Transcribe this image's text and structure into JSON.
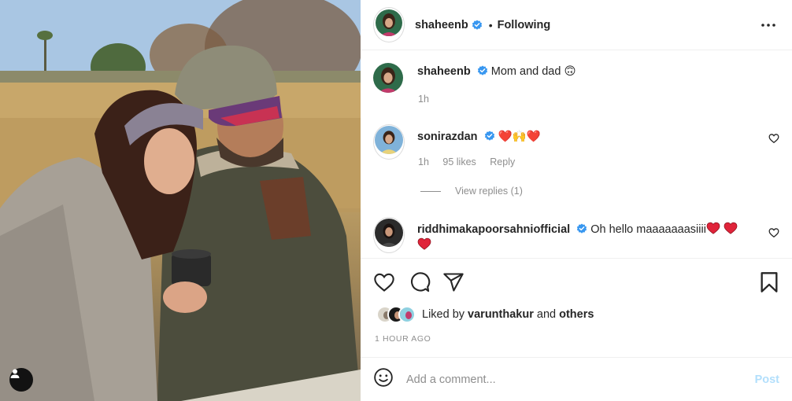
{
  "post": {
    "author": "shaheenb",
    "follow_state": "Following",
    "separator": "•",
    "more_icon": "more-options-icon"
  },
  "caption": {
    "username": "shaheenb",
    "text": "Mom and dad 🙃",
    "time": "1h"
  },
  "comments": [
    {
      "username": "sonirazdan",
      "text": "❤️🙌❤️",
      "time": "1h",
      "likes": "95 likes",
      "reply": "Reply",
      "view_replies": "View replies (1)"
    },
    {
      "username": "riddhimakapoorsahniofficial",
      "text_before": "Oh hello maaaaaaasiiii",
      "text_after": ""
    }
  ],
  "likes": {
    "prefix": "Liked by",
    "user": "varunthakur",
    "middle": "and",
    "suffix": "others"
  },
  "timestamp": "1 HOUR AGO",
  "add_comment": {
    "placeholder": "Add a comment...",
    "post_label": "Post"
  },
  "colors": {
    "verified": "#3897f0",
    "heart_red": "#ed4956",
    "post_disabled": "#b2dffc"
  }
}
